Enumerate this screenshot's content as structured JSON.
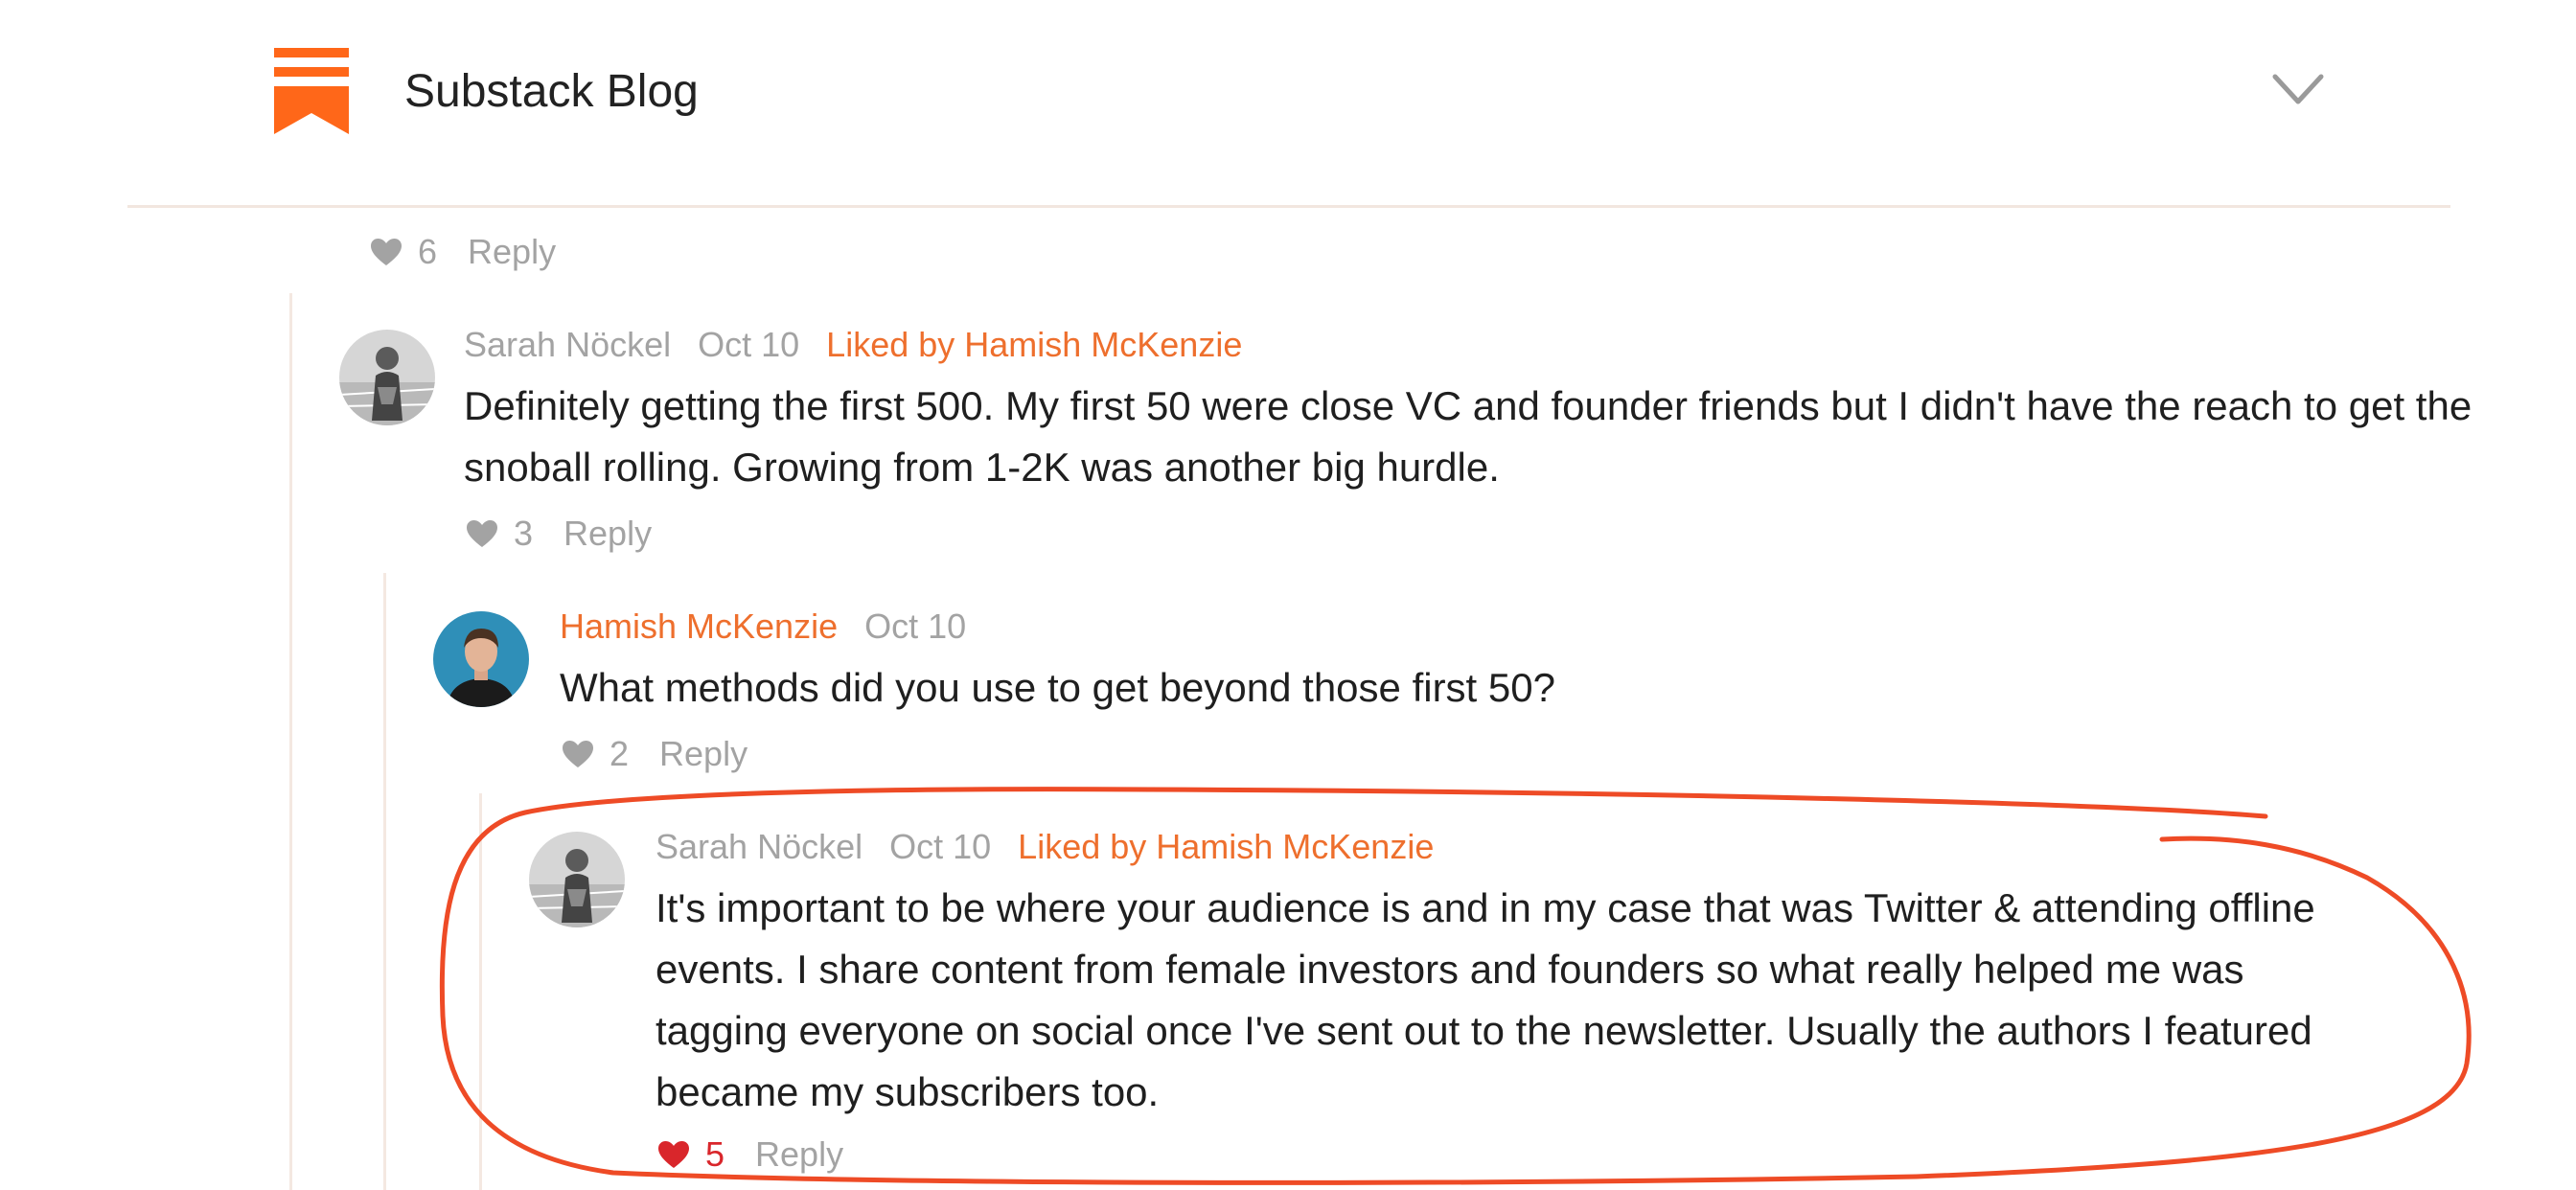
{
  "header": {
    "title": "Substack Blog",
    "logo_icon": "substack-logo-icon",
    "menu_icon": "chevron-down-icon",
    "accent_color": "#ee6f2d"
  },
  "parent_actions": {
    "likes": "6",
    "reply_label": "Reply"
  },
  "comments": [
    {
      "author": "Sarah Nöckel",
      "date": "Oct 10",
      "liked_by": "Liked by Hamish McKenzie",
      "text": "Definitely getting the first 500. My first 50 were close VC and founder friends but I didn't have the reach to get the snoball rolling. Growing from 1-2K was another big hurdle.",
      "likes": "3",
      "reply_label": "Reply"
    },
    {
      "author": "Hamish McKenzie",
      "date": "Oct 10",
      "liked_by": "",
      "text": "What methods did you use to get beyond those first 50?",
      "likes": "2",
      "reply_label": "Reply"
    },
    {
      "author": "Sarah Nöckel",
      "date": "Oct 10",
      "liked_by": "Liked by Hamish McKenzie",
      "text": "It's important to be where your audience is and in my case that was Twitter & attending offline events. I share content from female investors and founders so what really helped me was tagging everyone on social once I've sent out to the newsletter. Usually the authors I featured became my subscribers too.",
      "likes": "5",
      "liked": true,
      "reply_label": "Reply"
    }
  ],
  "colors": {
    "accent": "#ee6f2d",
    "muted": "#a3a3a3",
    "liked_heart": "#d9262b",
    "annotation": "#ee4b26"
  }
}
